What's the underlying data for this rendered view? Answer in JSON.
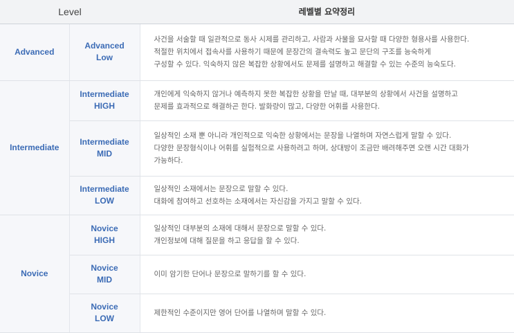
{
  "header": {
    "level": "Level",
    "summary": "레벨별 요약정리"
  },
  "rows": [
    {
      "group": "Advanced",
      "sub1": "Advanced",
      "sub2": "Low",
      "lines": [
        "사건을 서술할 때 일관적으로 동사 시제를 관리하고, 사람과 사물을 묘사할 때 다양한 형용사를 사용한다.",
        "적절한 위치에서 접속사를 사용하기 때문에 문장간의 결속력도 높고 문단의 구조를 능숙하게",
        "구성할 수 있다. 익숙하지 않은 복잡한 상황에서도 문제를 설명하고 해결할 수 있는 수준의 능숙도다."
      ]
    },
    {
      "group": "Intermediate",
      "sub1": "Intermediate",
      "sub2": "HIGH",
      "lines": [
        "개인에게 익숙하지 않거나 예측하지 못한 복잡한 상황을 만날 때, 대부분의 상황에서 사건을 설명하고",
        "문제를 효과적으로 해결하곤 한다. 발화량이 많고, 다양한 어휘를 사용한다."
      ]
    },
    {
      "sub1": "Intermediate",
      "sub2": "MID",
      "lines": [
        "일상적인 소재 뿐 아니라 개인적으로 익숙한 상황에서는 문장을 나열하며 자연스럽게 말할 수 있다.",
        "다양한 문장형식이나 어휘를 실험적으로 사용하려고 하며, 상대방이 조금만 배려해주면 오랜 시간 대화가",
        "가능하다."
      ]
    },
    {
      "sub1": "Intermediate",
      "sub2": "LOW",
      "lines": [
        "일상적인 소재에서는 문장으로 말할 수 있다.",
        "대화에 참여하고 선호하는 소재에서는 자신감을 가지고 말할 수 있다."
      ]
    },
    {
      "group": "Novice",
      "sub1": "Novice",
      "sub2": "HIGH",
      "lines": [
        "일상적인 대부분의 소재에 대해서 문장으로 말할 수 있다.",
        "개인정보에 대해 질문을 하고 응답을 할 수 있다."
      ]
    },
    {
      "sub1": "Novice",
      "sub2": "MID",
      "lines": [
        "이미 암기한 단어나 문장으로 말하기를 할 수 있다."
      ]
    },
    {
      "sub1": "Novice",
      "sub2": "LOW",
      "lines": [
        "제한적인 수준이지만 영어 단어를 나열하며 말할 수 있다."
      ]
    }
  ]
}
